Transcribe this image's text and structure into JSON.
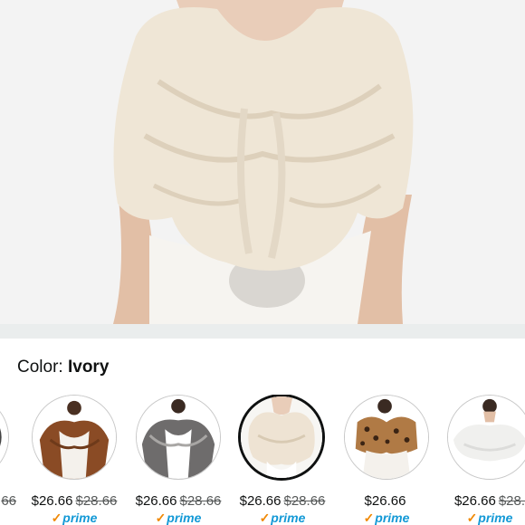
{
  "product": {
    "image_alt_icon": "ivory-faux-fur-shawl-photo"
  },
  "color_selector": {
    "label": "Color:",
    "selected_value": "Ivory"
  },
  "swatches": [
    {
      "price": "",
      "was": "66",
      "prime": "",
      "selected": false,
      "color": "#ffffff"
    },
    {
      "price": "$26.66",
      "was": "$28.66",
      "prime": "prime",
      "selected": false,
      "color": "#8a4b25"
    },
    {
      "price": "$26.66",
      "was": "$28.66",
      "prime": "prime",
      "selected": false,
      "color": "#6e6c6c"
    },
    {
      "price": "$26.66",
      "was": "$28.66",
      "prime": "prime",
      "selected": true,
      "color": "#eee3d3"
    },
    {
      "price": "$26.66",
      "was": "",
      "prime": "prime",
      "selected": false,
      "color": "#7a4a22"
    },
    {
      "price": "$26.66",
      "was": "$28.",
      "prime": "prime",
      "selected": false,
      "color": "#f7f7f5"
    }
  ],
  "colors": {
    "prime_blue": "#1399d6",
    "prime_check": "#f08804",
    "strike_gray": "#565959",
    "divider": "#eaeded"
  }
}
